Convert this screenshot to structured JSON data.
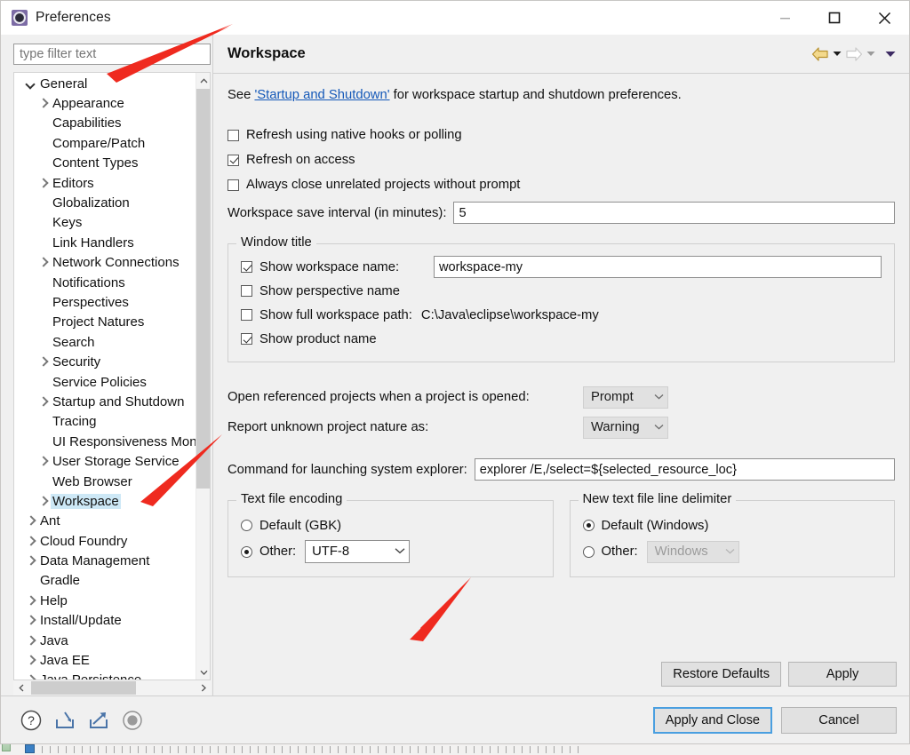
{
  "window": {
    "title": "Preferences",
    "icon": "eclipse-icon",
    "buttons": {
      "minimize": "minimize-icon",
      "maximize": "maximize-icon",
      "close": "close-icon"
    }
  },
  "sidebar": {
    "filter": {
      "placeholder": "type filter text",
      "value": ""
    },
    "items": [
      {
        "label": "General",
        "level": 1,
        "twisty": "down",
        "selected": false
      },
      {
        "label": "Appearance",
        "level": 2,
        "twisty": "right",
        "selected": false
      },
      {
        "label": "Capabilities",
        "level": 2,
        "twisty": "none",
        "selected": false
      },
      {
        "label": "Compare/Patch",
        "level": 2,
        "twisty": "none",
        "selected": false
      },
      {
        "label": "Content Types",
        "level": 2,
        "twisty": "none",
        "selected": false
      },
      {
        "label": "Editors",
        "level": 2,
        "twisty": "right",
        "selected": false
      },
      {
        "label": "Globalization",
        "level": 2,
        "twisty": "none",
        "selected": false
      },
      {
        "label": "Keys",
        "level": 2,
        "twisty": "none",
        "selected": false
      },
      {
        "label": "Link Handlers",
        "level": 2,
        "twisty": "none",
        "selected": false
      },
      {
        "label": "Network Connections",
        "level": 2,
        "twisty": "right",
        "selected": false
      },
      {
        "label": "Notifications",
        "level": 2,
        "twisty": "none",
        "selected": false
      },
      {
        "label": "Perspectives",
        "level": 2,
        "twisty": "none",
        "selected": false
      },
      {
        "label": "Project Natures",
        "level": 2,
        "twisty": "none",
        "selected": false
      },
      {
        "label": "Search",
        "level": 2,
        "twisty": "none",
        "selected": false
      },
      {
        "label": "Security",
        "level": 2,
        "twisty": "right",
        "selected": false
      },
      {
        "label": "Service Policies",
        "level": 2,
        "twisty": "none",
        "selected": false
      },
      {
        "label": "Startup and Shutdown",
        "level": 2,
        "twisty": "right",
        "selected": false
      },
      {
        "label": "Tracing",
        "level": 2,
        "twisty": "none",
        "selected": false
      },
      {
        "label": "UI Responsiveness Monitoring",
        "level": 2,
        "twisty": "none",
        "selected": false
      },
      {
        "label": "User Storage Service",
        "level": 2,
        "twisty": "right",
        "selected": false
      },
      {
        "label": "Web Browser",
        "level": 2,
        "twisty": "none",
        "selected": false
      },
      {
        "label": "Workspace",
        "level": 2,
        "twisty": "right",
        "selected": true
      },
      {
        "label": "Ant",
        "level": 1,
        "twisty": "right",
        "selected": false
      },
      {
        "label": "Cloud Foundry",
        "level": 1,
        "twisty": "right",
        "selected": false
      },
      {
        "label": "Data Management",
        "level": 1,
        "twisty": "right",
        "selected": false
      },
      {
        "label": "Gradle",
        "level": 1,
        "twisty": "none",
        "selected": false
      },
      {
        "label": "Help",
        "level": 1,
        "twisty": "right",
        "selected": false
      },
      {
        "label": "Install/Update",
        "level": 1,
        "twisty": "right",
        "selected": false
      },
      {
        "label": "Java",
        "level": 1,
        "twisty": "right",
        "selected": false
      },
      {
        "label": "Java EE",
        "level": 1,
        "twisty": "right",
        "selected": false
      },
      {
        "label": "Java Persistence",
        "level": 1,
        "twisty": "right",
        "selected": false
      }
    ]
  },
  "page": {
    "title": "Workspace",
    "nav": {
      "back_icon": "back-arrow-icon",
      "back_caret_icon": "chevron-down-icon",
      "forward_icon": "forward-arrow-icon",
      "forward_caret_icon": "chevron-down-icon",
      "menu_caret_icon": "chevron-down-icon"
    },
    "see_prefix": "See ",
    "see_link": "'Startup and Shutdown'",
    "see_suffix": " for workspace startup and shutdown preferences.",
    "checkboxes": [
      {
        "label": "Refresh using native hooks or polling",
        "checked": false
      },
      {
        "label": "Refresh on access",
        "checked": true
      },
      {
        "label": "Always close unrelated projects without prompt",
        "checked": false
      }
    ],
    "save_interval": {
      "label": "Workspace save interval (in minutes):",
      "value": "5"
    },
    "window_title_group": {
      "title": "Window title",
      "show_workspace_name": {
        "label": "Show workspace name:",
        "checked": true,
        "value": "workspace-my"
      },
      "show_perspective_name": {
        "label": "Show perspective name",
        "checked": false
      },
      "show_full_workspace_path": {
        "label": "Show full workspace path:",
        "checked": false,
        "path": "C:\\Java\\eclipse\\workspace-my"
      },
      "show_product_name": {
        "label": "Show product name",
        "checked": true
      }
    },
    "open_referenced": {
      "label": "Open referenced projects when a project is opened:",
      "value": "Prompt"
    },
    "report_nature": {
      "label": "Report unknown project nature as:",
      "value": "Warning"
    },
    "system_explorer": {
      "label": "Command for launching system explorer:",
      "value": "explorer /E,/select=${selected_resource_loc}"
    },
    "text_file_encoding": {
      "title": "Text file encoding",
      "default_label": "Default (GBK)",
      "default_selected": false,
      "other_label": "Other:",
      "other_selected": true,
      "other_value": "UTF-8"
    },
    "line_delimiter": {
      "title": "New text file line delimiter",
      "default_label": "Default (Windows)",
      "default_selected": true,
      "other_label": "Other:",
      "other_selected": false,
      "other_value": "Windows"
    },
    "buttons": {
      "restore": "Restore Defaults",
      "apply": "Apply"
    }
  },
  "footer": {
    "icons": [
      {
        "name": "help-icon"
      },
      {
        "name": "import-icon"
      },
      {
        "name": "export-icon"
      },
      {
        "name": "record-icon"
      }
    ],
    "apply_and_close": "Apply and Close",
    "cancel": "Cancel"
  },
  "colors": {
    "accent_selection": "#cde8f6",
    "link": "#1458b8",
    "annotation": "#ef2a1f",
    "nav_back": "#e8c468",
    "dialog_bg": "#f0f0f0",
    "primary_border": "#4a9fe0"
  }
}
